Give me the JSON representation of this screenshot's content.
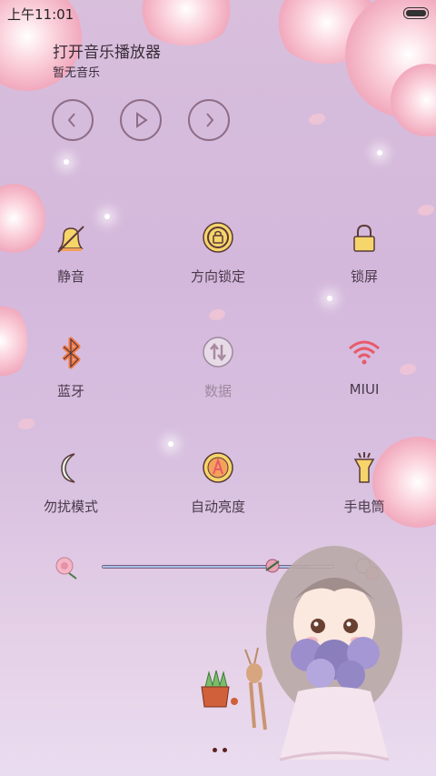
{
  "status_bar": {
    "time": "上午11:01"
  },
  "music": {
    "title": "打开音乐播放器",
    "subtitle": "暂无音乐",
    "controls": [
      {
        "name": "previous",
        "icon": "chevron-left-icon"
      },
      {
        "name": "play",
        "icon": "play-icon"
      },
      {
        "name": "next",
        "icon": "chevron-right-icon"
      }
    ]
  },
  "toggles": [
    {
      "label": "静音",
      "icon": "bell-muted-icon"
    },
    {
      "label": "方向锁定",
      "icon": "rotation-lock-icon"
    },
    {
      "label": "锁屏",
      "icon": "padlock-icon"
    },
    {
      "label": "蓝牙",
      "icon": "bluetooth-icon"
    },
    {
      "label": "数据",
      "icon": "mobile-data-icon",
      "state": "disabled"
    },
    {
      "label": "MIUI",
      "icon": "wifi-icon"
    },
    {
      "label": "勿扰模式",
      "icon": "moon-icon"
    },
    {
      "label": "自动亮度",
      "icon": "auto-brightness-icon"
    },
    {
      "label": "手电筒",
      "icon": "flashlight-icon"
    }
  ],
  "brightness": {
    "level": 0.9
  },
  "pager": {
    "pages": 2,
    "current": 1
  },
  "colors": {
    "accent": "#a8bfe6",
    "icon_stroke": "#8e6d87"
  }
}
